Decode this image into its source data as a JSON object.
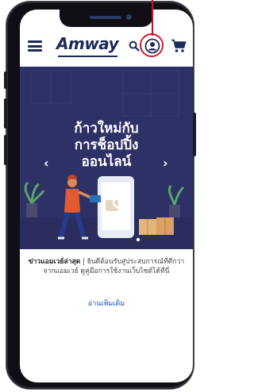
{
  "header": {
    "logo_text": "Amway",
    "icons": [
      "menu-icon",
      "search-icon",
      "account-icon",
      "cart-icon"
    ]
  },
  "banner": {
    "title_lines": [
      "ก้าวใหม่กับ",
      "การช็อปปิ้ง",
      "ออนไลน์"
    ],
    "prev_arrow": "‹",
    "next_arrow": "›"
  },
  "news": {
    "heading": "ข่าวแอมเวย์ล่าสุด",
    "separator": "|",
    "body": "ยินดีต้อนรับสู่ประสบการณ์ที่ดีกว่าจากแอมเวย์ ดูคู่มือการใช้งานเว็บไซต์ได้ที่นี่"
  },
  "read_more": "อ่านเพิ่มเติม",
  "colors": {
    "brand_navy": "#1a2a5a",
    "banner_bg": "#2d3166",
    "highlight_red": "#d11a2a",
    "link_blue": "#1a56b3"
  }
}
